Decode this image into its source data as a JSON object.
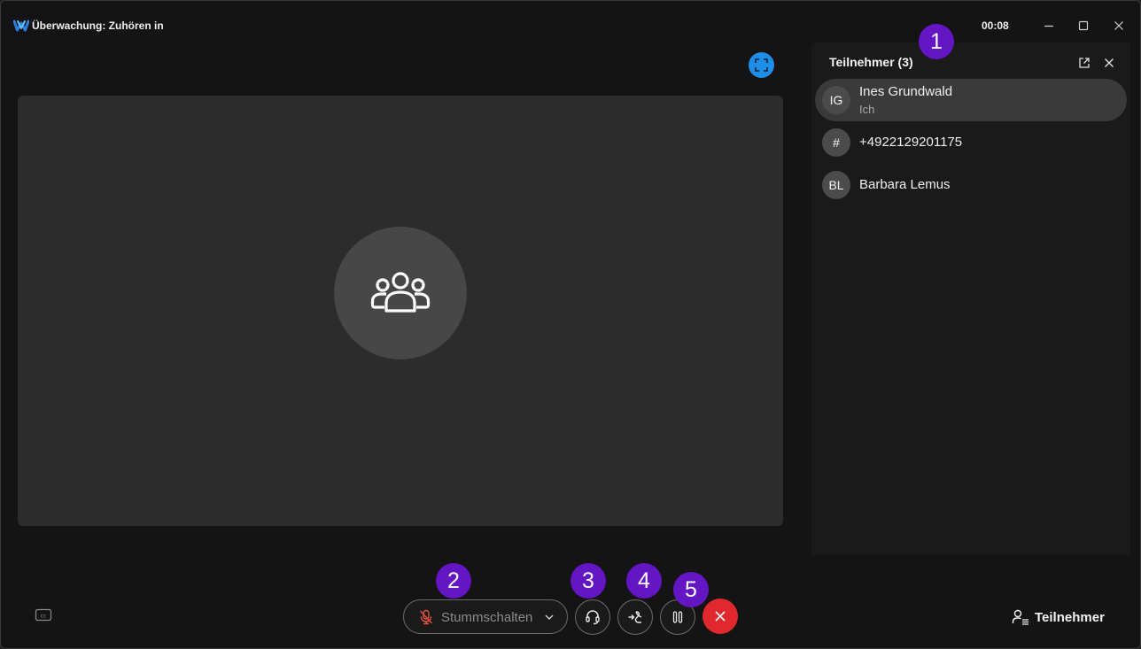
{
  "window": {
    "title": "Überwachung: Zuhören in",
    "timer": "00:08"
  },
  "panel": {
    "title": "Teilnehmer (3)",
    "participants": [
      {
        "initials": "IG",
        "name": "Ines Grundwald",
        "subtitle": "Ich"
      },
      {
        "initials": "#",
        "name": "+4922129201175"
      },
      {
        "initials": "BL",
        "name": "Barbara Lemus"
      }
    ]
  },
  "controls": {
    "mute_label": "Stummschalten",
    "participants_label": "Teilnehmer"
  },
  "badges": [
    "1",
    "2",
    "3",
    "4",
    "5"
  ],
  "colors": {
    "accent_blue": "#1f8ee8",
    "end_call_red": "#e0282e",
    "badge_purple": "#6415c4",
    "muted_mic_red": "#e0523a"
  }
}
